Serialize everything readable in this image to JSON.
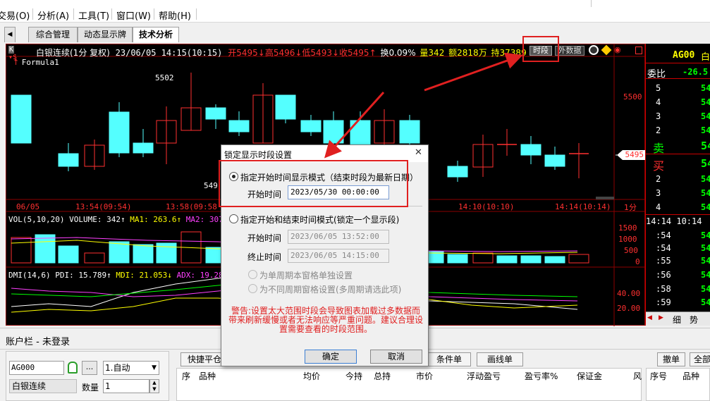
{
  "menu": {
    "items": [
      "交易(O)",
      "分析(A)",
      "工具(T)",
      "窗口(W)",
      "帮助(H)"
    ]
  },
  "tabs": {
    "collapse_label": "◀",
    "items": [
      "综合管理",
      "动态显示牌",
      "技术分析"
    ]
  },
  "chart": {
    "header": {
      "name": "白银连续(1分 复权)",
      "datetime": "23/06/05 14:15(10:15)",
      "open": "开5495↓",
      "high": "高5496↓",
      "low": "低5493↓",
      "close": "收5495↑",
      "change": "换0.09%",
      "volume": "量342",
      "amount": "额2818万",
      "position": "持37389",
      "period_button": "时段",
      "external_button": "外数据"
    },
    "formula_label": "Formula1",
    "price_labels": {
      "high_mark": "5502",
      "low_mark": "549",
      "axis_5500": "5500",
      "current": "5495"
    },
    "time_axis": [
      "06/05",
      "13:54(09:54)",
      "13:58(09:58",
      "14:10(10:10)",
      "14:14(10:14)",
      "1分"
    ],
    "vol_indicator": {
      "title": "VOL(5,10,20)",
      "volume": "VOLUME: 342↑",
      "ma1": "MA1: 263.6↑",
      "ma2": "MA2: 307"
    },
    "vol_axis": [
      "1500",
      "1000",
      "500",
      "0"
    ],
    "dmi_indicator": {
      "title": "DMI(14,6)",
      "pdi": "PDI: 15.789↑",
      "mdi": "MDI: 21.053↓",
      "adx": "ADX: 19.28"
    },
    "dmi_axis": [
      "40.00",
      "20.00"
    ],
    "colors": {
      "bull": "#ff3030",
      "bear": "#54ffff",
      "ma1": "#ffff00",
      "ma2": "#ff40ff",
      "accent": "#e02020"
    }
  },
  "right_panel": {
    "code": "AG00",
    "name_fragment": "白",
    "wei_bi_label": "委比",
    "wei_bi_value": "-26.5",
    "sell_label": "卖",
    "buy_label": "买",
    "sell_levels": [
      "5",
      "4",
      "3",
      "2"
    ],
    "buy_levels": [
      "2",
      "3",
      "4"
    ],
    "price_fragments": [
      "54",
      "54",
      "54",
      "54",
      "54",
      "54",
      "54",
      "54",
      "54",
      "54"
    ],
    "trade_header": "14:14 10:14",
    "trade_times": [
      ":54",
      ":54",
      ":55",
      ":56",
      ":58",
      ":59"
    ],
    "tabs": [
      "细",
      "势"
    ]
  },
  "account": {
    "title": "账户栏 - 未登录",
    "code_input": "AG000",
    "name": "白银连续",
    "mode": "1.自动",
    "qty_label": "数量",
    "qty_value": "1",
    "more_button": "..."
  },
  "order_buttons": [
    "快捷平仓",
    "条件单",
    "画线单"
  ],
  "right_buttons": [
    "撤单",
    "全部"
  ],
  "position_table": {
    "headers": [
      "序",
      "品种",
      "均价",
      "今持",
      "总持",
      "市价",
      "浮动盈亏",
      "盈亏率%",
      "保证金",
      "风"
    ]
  },
  "order_table": {
    "headers": [
      "序号",
      "品种"
    ]
  },
  "dialog": {
    "title": "锁定显示时段设置",
    "close_label": "✕",
    "mode1_label": "指定开始时间显示模式（结束时段为最新日期）",
    "start_label": "开始时间",
    "start_value": "2023/05/30 00:00:00",
    "mode2_label": "指定开始和结束时间模式(锁定一个显示段)",
    "start2_label": "开始时间",
    "start2_value": "2023/06/05 13:52:00",
    "end_label": "终止时间",
    "end_value": "2023/06/05 14:15:00",
    "opt_single": "为单周期本窗格单独设置",
    "opt_multi": "为不同周期窗格设置(多周期请选此项)",
    "warning": "警告:设置太大范围时段会导致图表加载过多数据而带来刷新缓慢或者无法响应等严重问题。建议合理设置需要查看的时段范围。",
    "ok_label": "确定",
    "cancel_label": "取消"
  }
}
